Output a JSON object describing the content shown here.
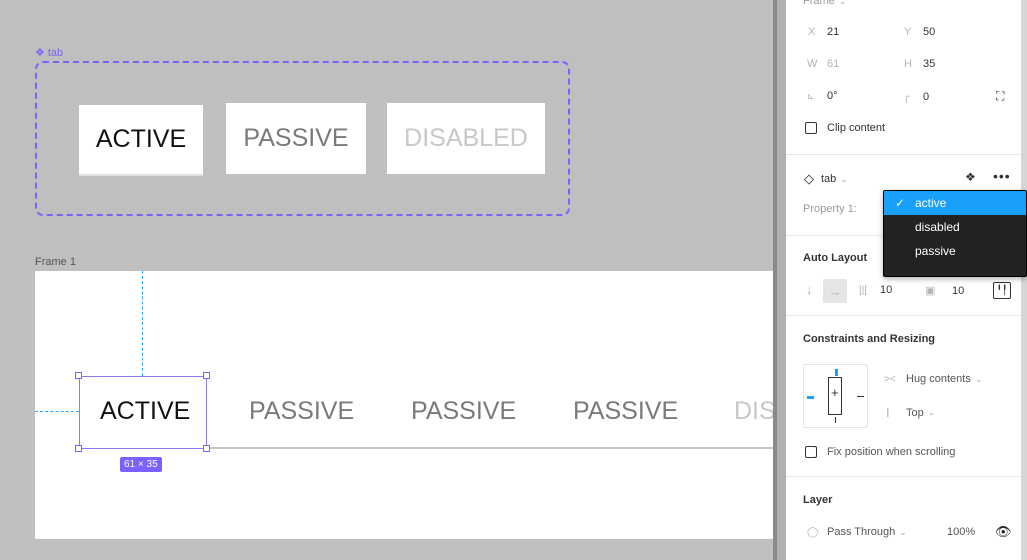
{
  "canvas": {
    "component_set": {
      "label": "tab",
      "icon": "component-set-icon",
      "variants": [
        "ACTIVE",
        "PASSIVE",
        "DISABLED"
      ]
    },
    "frame": {
      "label": "Frame 1",
      "tabs": [
        "ACTIVE",
        "PASSIVE",
        "PASSIVE",
        "PASSIVE",
        "DISA"
      ],
      "selection_size": "61 × 35"
    }
  },
  "panel": {
    "frame_section": {
      "header": "Frame",
      "x_label": "X",
      "x_value": "21",
      "y_label": "Y",
      "y_value": "50",
      "w_label": "W",
      "w_value": "61",
      "h_label": "H",
      "h_value": "35",
      "rotation_value": "0°",
      "radius_value": "0",
      "clip_content_label": "Clip content",
      "clip_content_checked": false
    },
    "instance_section": {
      "name": "tab",
      "property_label": "Property 1:",
      "dropdown": {
        "options": [
          "active",
          "disabled",
          "passive"
        ],
        "selected": "active"
      }
    },
    "auto_layout": {
      "title": "Auto Layout",
      "spacing": "10",
      "padding": "10"
    },
    "constraints": {
      "title": "Constraints and Resizing",
      "horizontal": "Hug contents",
      "vertical": "Top",
      "fix_position_label": "Fix position when scrolling",
      "fix_position_checked": false
    },
    "layer": {
      "title": "Layer",
      "blend_mode": "Pass Through",
      "opacity": "100%"
    }
  },
  "colors": {
    "accent_purple": "#7b61ff",
    "selection_blue": "#18a0fb",
    "guide_blue": "#32a6ff"
  }
}
